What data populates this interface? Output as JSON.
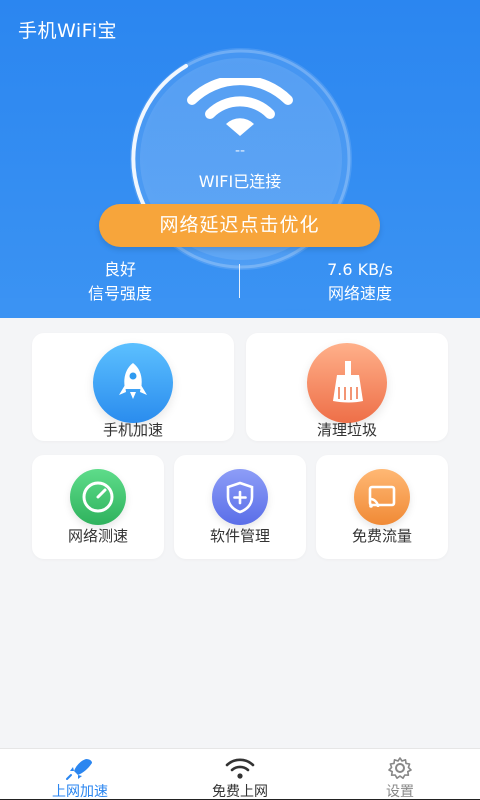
{
  "app": {
    "title": "手机WiFi宝"
  },
  "status": {
    "ssid_placeholder": "--",
    "connection": "WIFI已连接"
  },
  "optimize_button": {
    "label": "网络延迟点击优化"
  },
  "stats": {
    "signal": {
      "value": "良好",
      "label": "信号强度"
    },
    "speed": {
      "value": "7.6 KB/s",
      "label": "网络速度"
    }
  },
  "features": [
    {
      "label": "手机加速",
      "icon": "rocket-icon",
      "color": "#2f9bf0"
    },
    {
      "label": "清理垃圾",
      "icon": "broom-icon",
      "color": "#f07b52"
    },
    {
      "label": "网络测速",
      "icon": "speedometer-icon",
      "color": "#3cc16a"
    },
    {
      "label": "软件管理",
      "icon": "shield-plus-icon",
      "color": "#6b7ff2"
    },
    {
      "label": "免费流量",
      "icon": "cast-icon",
      "color": "#f7964a"
    }
  ],
  "tabbar": {
    "tabs": [
      {
        "label": "上网加速",
        "icon": "rocket-icon",
        "active": true
      },
      {
        "label": "免费上网",
        "icon": "wifi-icon",
        "active": false
      },
      {
        "label": "设置",
        "icon": "gear-icon",
        "active": false
      }
    ]
  },
  "colors": {
    "header_blue": "#2b86f0",
    "accent_orange": "#f7a53b",
    "active_tab": "#2b86f0"
  }
}
